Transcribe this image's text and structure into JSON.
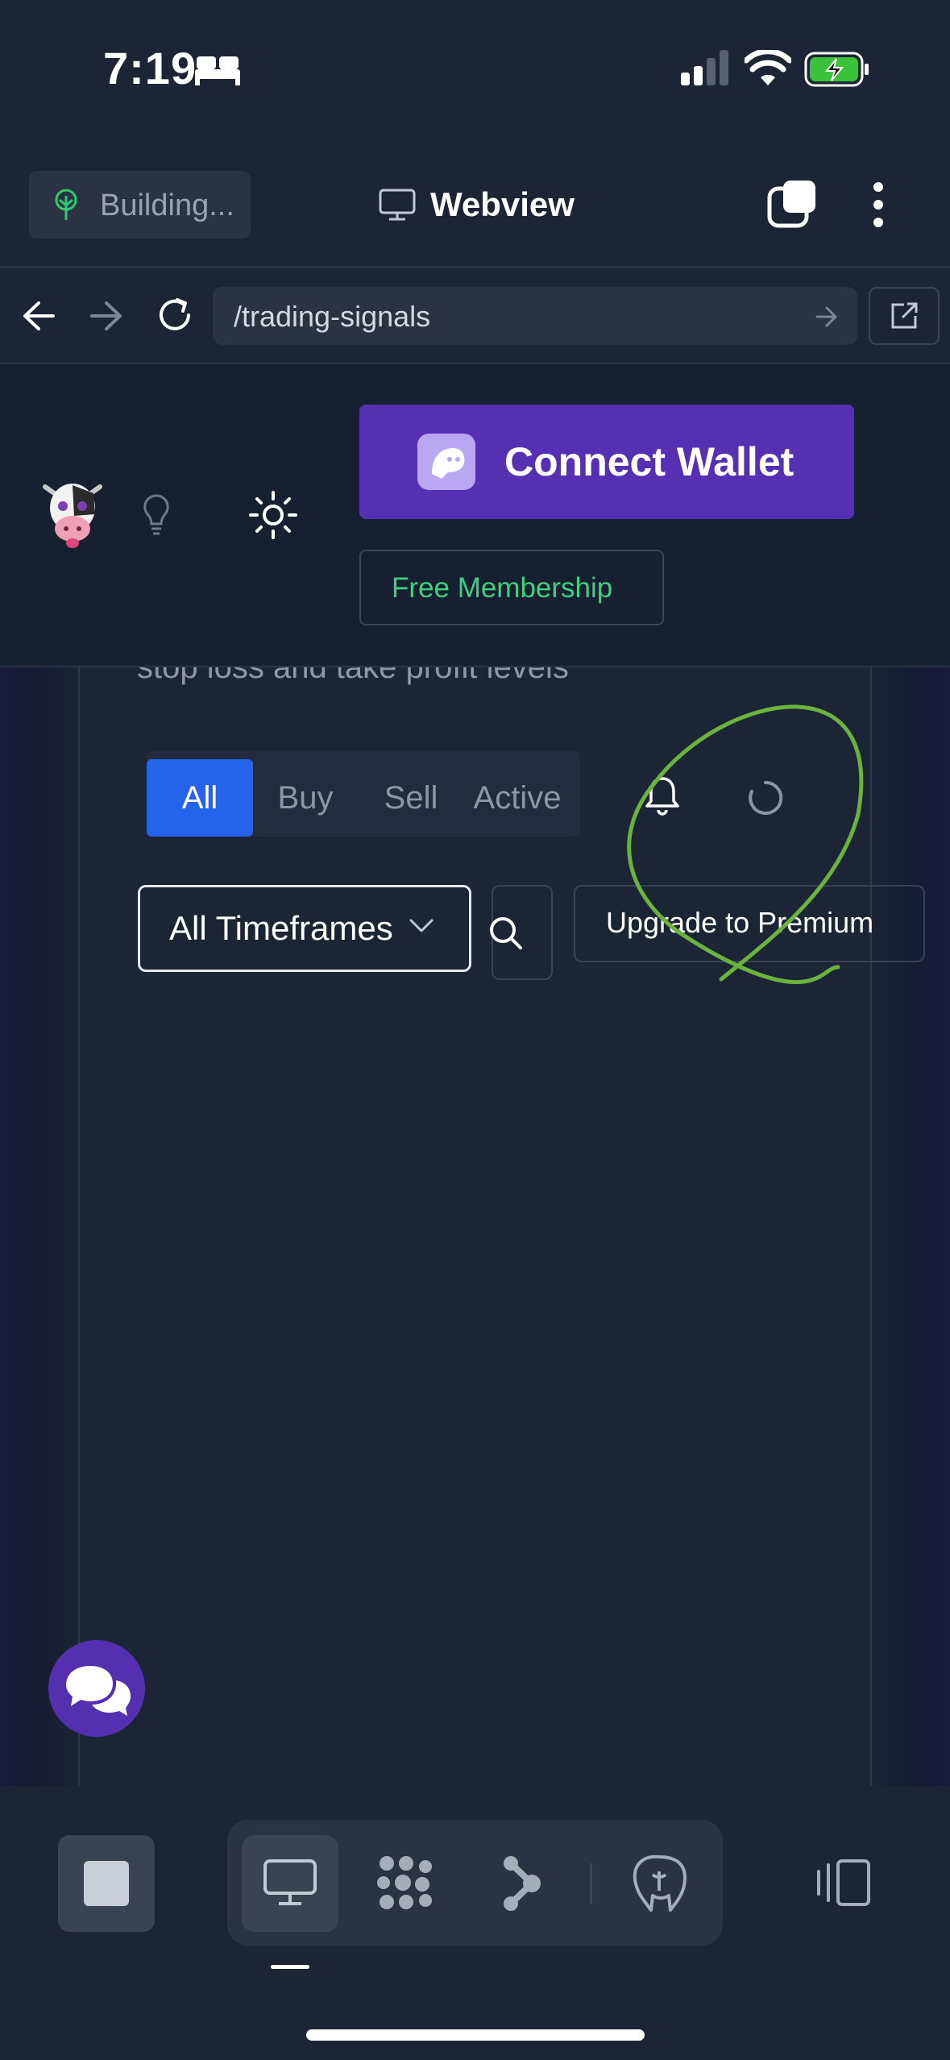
{
  "status_bar": {
    "time": "7:19"
  },
  "webview_bar": {
    "build_status": "Building...",
    "title": "Webview"
  },
  "url_bar": {
    "url": "/trading-signals"
  },
  "site_header": {
    "connect_wallet_label": "Connect Wallet",
    "free_membership_label": "Free Membership"
  },
  "page": {
    "subtitle": "stop loss and take profit levels",
    "filters": [
      "All",
      "Buy",
      "Sell",
      "Active"
    ],
    "active_filter": "All",
    "timeframe_selected": "All Timeframes",
    "upgrade_label": "Upgrade to Premium"
  },
  "colors": {
    "accent_blue": "#2563eb",
    "wallet_purple": "#5530b3",
    "membership_green": "#3ed07e",
    "annotation_green": "#6cb33e"
  },
  "icons": {
    "status": [
      "bed-icon",
      "cellular-signal-icon",
      "wifi-icon",
      "battery-charging-icon"
    ],
    "toolbar": [
      "tree-icon",
      "monitor-icon",
      "tabs-icon",
      "more-vertical-icon"
    ],
    "nav": [
      "back-icon",
      "forward-icon",
      "reload-icon",
      "go-arrow-icon",
      "open-external-icon"
    ],
    "header": [
      "cow-logo-icon",
      "lightbulb-icon",
      "sun-icon",
      "ghost-wallet-icon"
    ],
    "page": [
      "bell-icon",
      "spinner-icon",
      "chevron-down-icon",
      "search-icon",
      "chat-icon"
    ],
    "dock": [
      "stop-icon",
      "monitor-icon",
      "grid-dots-icon",
      "share-nodes-icon",
      "postgres-elephant-icon",
      "sidebar-toggle-icon"
    ]
  }
}
